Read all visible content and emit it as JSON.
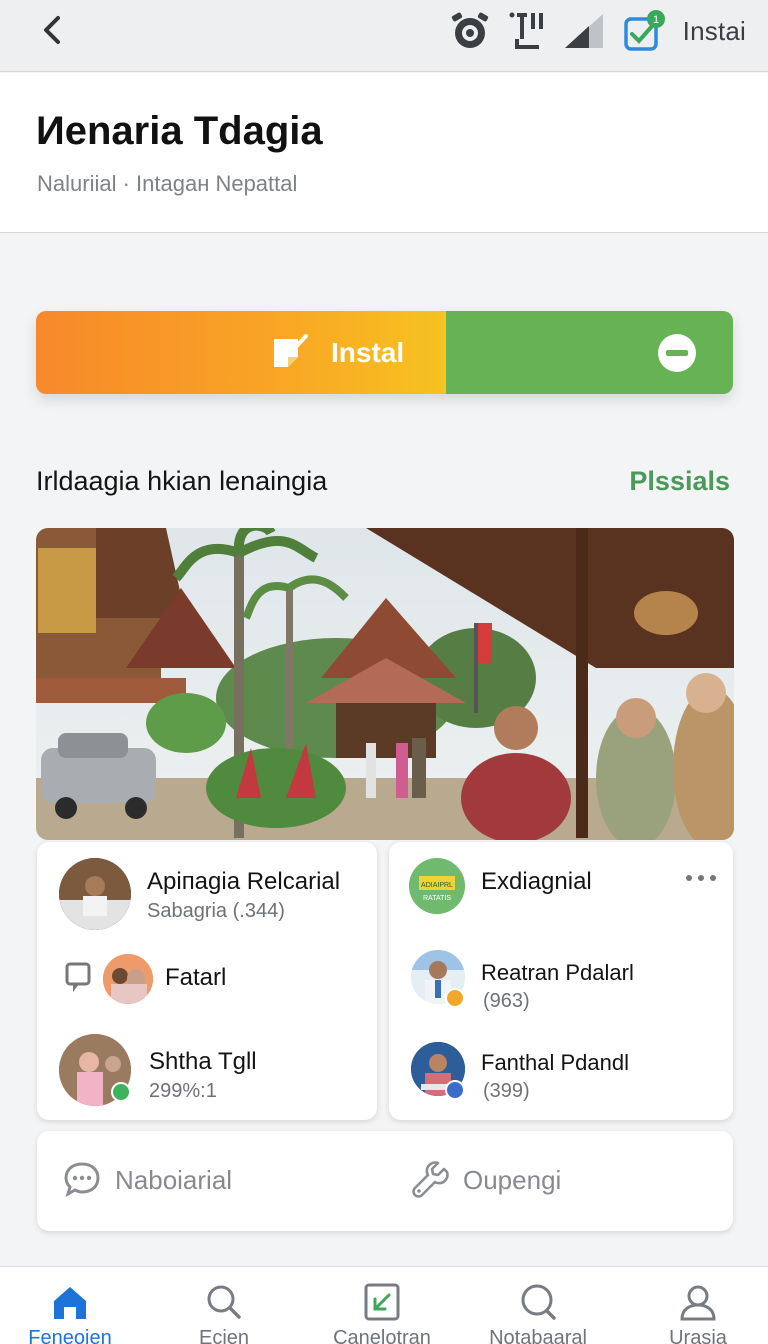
{
  "status_bar": {
    "right_text": "Instai"
  },
  "header": {
    "title": "Иenaria Tdagia",
    "subtitle": "Naluriial · Intagaн Nepattal"
  },
  "install_button": {
    "label": "Instal"
  },
  "section": {
    "title": "Irldaagia hkian lenaingia",
    "link": "Plssials"
  },
  "card_left": {
    "rows": [
      {
        "title": "Apiпagia Relcarial",
        "sub": "Sabagria (.344)"
      },
      {
        "title": "Fatarl"
      },
      {
        "title": "Shtha Tgll",
        "sub": "299%:1"
      }
    ]
  },
  "card_right": {
    "header": {
      "title": "Exdiagnial",
      "logo_text_top": "ADIAIPRL",
      "logo_text_bottom": "RATATIS"
    },
    "rows": [
      {
        "title": "Reatran Pdalarl",
        "sub": "(963)"
      },
      {
        "title": "Fanthal Pdandl",
        "sub": "(399)"
      }
    ]
  },
  "actions": [
    {
      "label": "Naboiarial",
      "icon": "chat-bubble-icon"
    },
    {
      "label": "Oupengi",
      "icon": "wrench-icon"
    }
  ],
  "bottom_nav": [
    {
      "label": "Feneoien",
      "icon": "home-icon",
      "active": true
    },
    {
      "label": "Ecien",
      "icon": "search-icon"
    },
    {
      "label": "Canelotran",
      "icon": "arrow-box-icon"
    },
    {
      "label": "Notabaaral",
      "icon": "search-icon"
    },
    {
      "label": "Urasia",
      "icon": "user-icon"
    }
  ],
  "colors": {
    "install_orange": "#f7892a",
    "install_yellow": "#f6c31f",
    "install_green": "#67b255",
    "link_green": "#4b9a5a",
    "nav_active": "#1e73d9"
  }
}
